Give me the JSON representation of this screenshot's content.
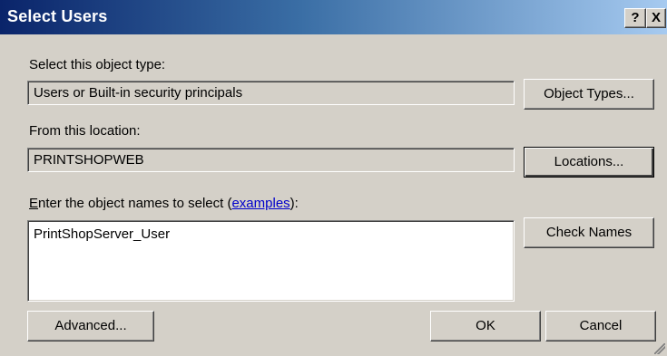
{
  "window": {
    "title": "Select Users",
    "help_button": "?",
    "close_button": "X"
  },
  "object_type": {
    "label": "Select this object type:",
    "value": "Users or Built-in security principals",
    "button_label": "Object Types..."
  },
  "location": {
    "label": "From this location:",
    "value": "PRINTSHOPWEB",
    "button_label": "Locations..."
  },
  "names": {
    "label_mnemonic": "E",
    "label_rest": "nter the object names to select (",
    "examples_link": "examples",
    "label_suffix": "):",
    "value": "PrintShopServer_User",
    "check_names_label": "Check Names"
  },
  "footer": {
    "advanced_label": "Advanced...",
    "ok_label": "OK",
    "cancel_label": "Cancel"
  }
}
